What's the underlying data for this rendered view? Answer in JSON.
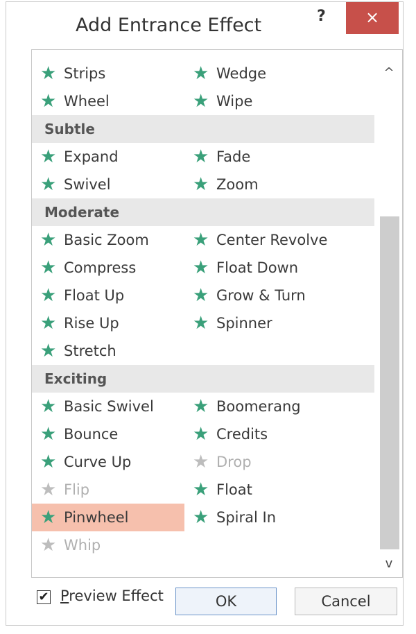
{
  "dialog": {
    "title": "Add Entrance Effect",
    "help_label": "?",
    "close_label": "×"
  },
  "list": {
    "rows": [
      {
        "type": "item",
        "left": {
          "label": "Strips",
          "disabled": false
        },
        "right": {
          "label": "Wedge",
          "disabled": false
        }
      },
      {
        "type": "item",
        "left": {
          "label": "Wheel",
          "disabled": false
        },
        "right": {
          "label": "Wipe",
          "disabled": false
        }
      },
      {
        "type": "group",
        "label": "Subtle"
      },
      {
        "type": "item",
        "left": {
          "label": "Expand",
          "disabled": false
        },
        "right": {
          "label": "Fade",
          "disabled": false
        }
      },
      {
        "type": "item",
        "left": {
          "label": "Swivel",
          "disabled": false
        },
        "right": {
          "label": "Zoom",
          "disabled": false
        }
      },
      {
        "type": "group",
        "label": "Moderate"
      },
      {
        "type": "item",
        "left": {
          "label": "Basic Zoom",
          "disabled": false
        },
        "right": {
          "label": "Center Revolve",
          "disabled": false
        }
      },
      {
        "type": "item",
        "left": {
          "label": "Compress",
          "disabled": false
        },
        "right": {
          "label": "Float Down",
          "disabled": false
        }
      },
      {
        "type": "item",
        "left": {
          "label": "Float Up",
          "disabled": false
        },
        "right": {
          "label": "Grow & Turn",
          "disabled": false
        }
      },
      {
        "type": "item",
        "left": {
          "label": "Rise Up",
          "disabled": false
        },
        "right": {
          "label": "Spinner",
          "disabled": false
        }
      },
      {
        "type": "item",
        "left": {
          "label": "Stretch",
          "disabled": false
        },
        "right": null
      },
      {
        "type": "group",
        "label": "Exciting"
      },
      {
        "type": "item",
        "left": {
          "label": "Basic Swivel",
          "disabled": false
        },
        "right": {
          "label": "Boomerang",
          "disabled": false
        }
      },
      {
        "type": "item",
        "left": {
          "label": "Bounce",
          "disabled": false
        },
        "right": {
          "label": "Credits",
          "disabled": false
        }
      },
      {
        "type": "item",
        "left": {
          "label": "Curve Up",
          "disabled": false
        },
        "right": {
          "label": "Drop",
          "disabled": true
        }
      },
      {
        "type": "item",
        "left": {
          "label": "Flip",
          "disabled": true
        },
        "right": {
          "label": "Float",
          "disabled": false
        }
      },
      {
        "type": "item",
        "left": {
          "label": "Pinwheel",
          "disabled": false,
          "selected": true
        },
        "right": {
          "label": "Spiral In",
          "disabled": false
        }
      },
      {
        "type": "item",
        "left": {
          "label": "Whip",
          "disabled": true
        },
        "right": null
      }
    ],
    "star_icon": "star-icon",
    "colors": {
      "star": "#3aa07a",
      "star_disabled": "#bdbdbd",
      "selected_bg": "#f6c0ad",
      "group_bg": "#e8e8e8"
    }
  },
  "scrollbar": {
    "up_glyph": "^",
    "down_glyph": "v"
  },
  "footer": {
    "preview_checked": true,
    "check_glyph": "✔",
    "preview_label_underlined": "P",
    "preview_label_rest": "review Effect",
    "ok_label": "OK",
    "cancel_label": "Cancel"
  }
}
